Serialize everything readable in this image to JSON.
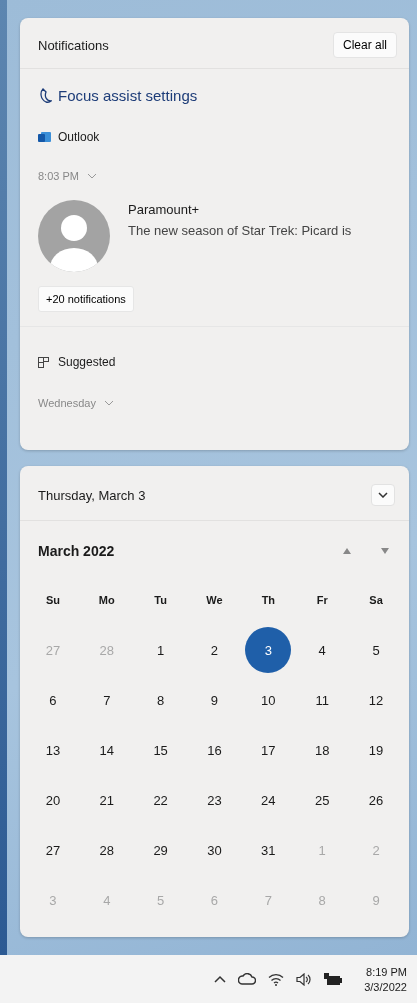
{
  "notifications": {
    "title": "Notifications",
    "clear_all": "Clear all",
    "focus_assist": "Focus assist settings",
    "app": "Outlook",
    "time": "8:03 PM",
    "toast": {
      "title": "Paramount+",
      "body": "The new season of Star Trek: Picard is"
    },
    "more": "+20 notifications",
    "suggested": "Suggested",
    "day_group": "Wednesday"
  },
  "calendar": {
    "date_header": "Thursday, March 3",
    "month": "March 2022",
    "weekdays": [
      "Su",
      "Mo",
      "Tu",
      "We",
      "Th",
      "Fr",
      "Sa"
    ],
    "weeks": [
      [
        {
          "day": "27",
          "muted": true,
          "selected": false
        },
        {
          "day": "28",
          "muted": true,
          "selected": false
        },
        {
          "day": "1",
          "muted": false,
          "selected": false
        },
        {
          "day": "2",
          "muted": false,
          "selected": false
        },
        {
          "day": "3",
          "muted": false,
          "selected": true
        },
        {
          "day": "4",
          "muted": false,
          "selected": false
        },
        {
          "day": "5",
          "muted": false,
          "selected": false
        }
      ],
      [
        {
          "day": "6",
          "muted": false,
          "selected": false
        },
        {
          "day": "7",
          "muted": false,
          "selected": false
        },
        {
          "day": "8",
          "muted": false,
          "selected": false
        },
        {
          "day": "9",
          "muted": false,
          "selected": false
        },
        {
          "day": "10",
          "muted": false,
          "selected": false
        },
        {
          "day": "11",
          "muted": false,
          "selected": false
        },
        {
          "day": "12",
          "muted": false,
          "selected": false
        }
      ],
      [
        {
          "day": "13",
          "muted": false,
          "selected": false
        },
        {
          "day": "14",
          "muted": false,
          "selected": false
        },
        {
          "day": "15",
          "muted": false,
          "selected": false
        },
        {
          "day": "16",
          "muted": false,
          "selected": false
        },
        {
          "day": "17",
          "muted": false,
          "selected": false
        },
        {
          "day": "18",
          "muted": false,
          "selected": false
        },
        {
          "day": "19",
          "muted": false,
          "selected": false
        }
      ],
      [
        {
          "day": "20",
          "muted": false,
          "selected": false
        },
        {
          "day": "21",
          "muted": false,
          "selected": false
        },
        {
          "day": "22",
          "muted": false,
          "selected": false
        },
        {
          "day": "23",
          "muted": false,
          "selected": false
        },
        {
          "day": "24",
          "muted": false,
          "selected": false
        },
        {
          "day": "25",
          "muted": false,
          "selected": false
        },
        {
          "day": "26",
          "muted": false,
          "selected": false
        }
      ],
      [
        {
          "day": "27",
          "muted": false,
          "selected": false
        },
        {
          "day": "28",
          "muted": false,
          "selected": false
        },
        {
          "day": "29",
          "muted": false,
          "selected": false
        },
        {
          "day": "30",
          "muted": false,
          "selected": false
        },
        {
          "day": "31",
          "muted": false,
          "selected": false
        },
        {
          "day": "1",
          "muted": true,
          "selected": false
        },
        {
          "day": "2",
          "muted": true,
          "selected": false
        }
      ],
      [
        {
          "day": "3",
          "muted": true,
          "selected": false
        },
        {
          "day": "4",
          "muted": true,
          "selected": false
        },
        {
          "day": "5",
          "muted": true,
          "selected": false
        },
        {
          "day": "6",
          "muted": true,
          "selected": false
        },
        {
          "day": "7",
          "muted": true,
          "selected": false
        },
        {
          "day": "8",
          "muted": true,
          "selected": false
        },
        {
          "day": "9",
          "muted": true,
          "selected": false
        }
      ]
    ]
  },
  "taskbar": {
    "time": "8:19 PM",
    "date": "3/3/2022"
  }
}
